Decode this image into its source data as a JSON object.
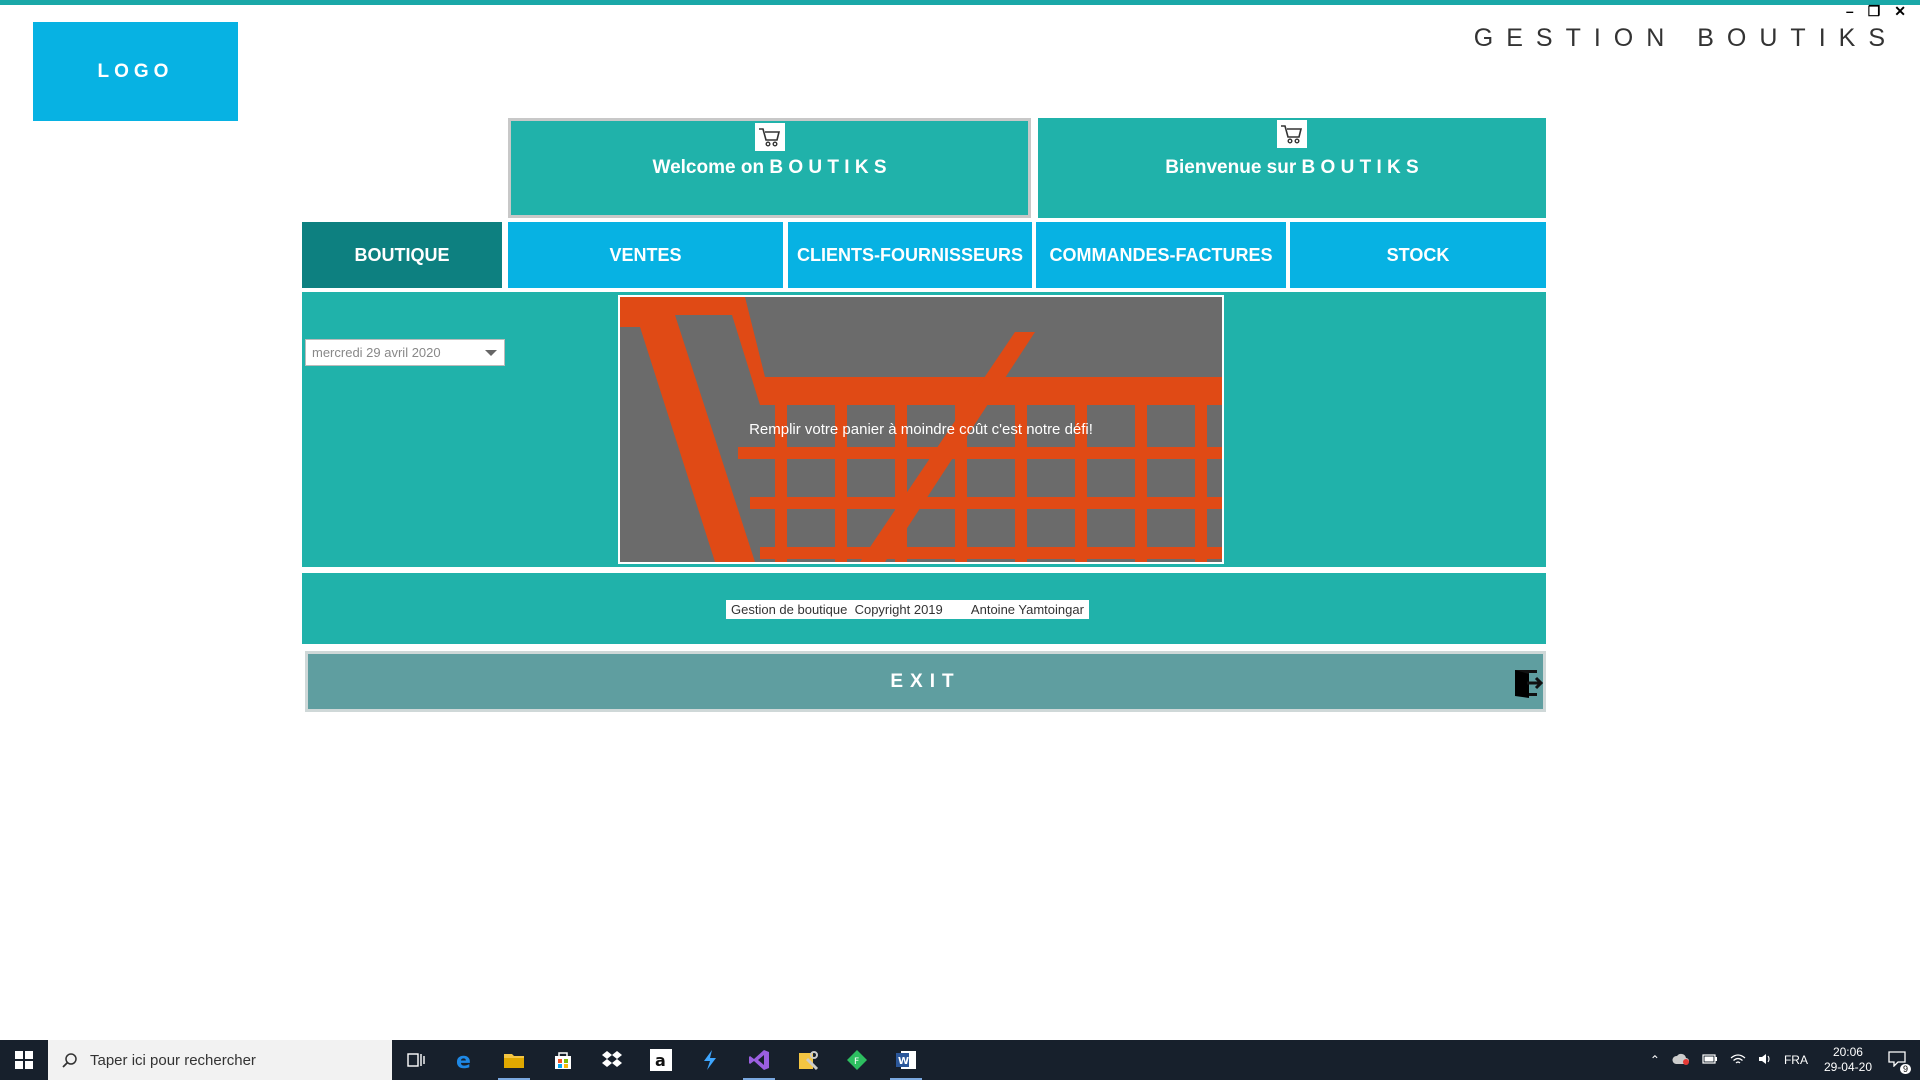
{
  "header": {
    "logo_text": "LOGO",
    "app_title": "GESTION BOUTIKS"
  },
  "welcome": {
    "english": "Welcome on B O U T I K S",
    "french": "Bienvenue sur  B O U T I K S"
  },
  "nav": {
    "items": [
      {
        "label": "BOUTIQUE",
        "active": true
      },
      {
        "label": "VENTES",
        "active": false
      },
      {
        "label": "CLIENTS-FOURNISSEURS",
        "active": false
      },
      {
        "label": "COMMANDES-FACTURES",
        "active": false
      },
      {
        "label": "STOCK",
        "active": false
      }
    ]
  },
  "main": {
    "date_value": "mercredi 29 avril 2020",
    "banner_text": "Remplir votre panier à moindre coût c'est notre défi!"
  },
  "footer": {
    "copyright": "Gestion de boutique  Copyright 2019        Antoine Yamtoingar"
  },
  "exit": {
    "label": "EXIT"
  },
  "taskbar": {
    "search_placeholder": "Taper ici pour rechercher",
    "language": "FRA",
    "time": "20:06",
    "date": "29-04-20",
    "notification_count": "9",
    "apps": [
      "task-view-icon",
      "edge-icon",
      "file-explorer-icon",
      "store-icon",
      "dropbox-icon",
      "amazon-icon",
      "vscode-icon",
      "visual-studio-icon",
      "tools-icon",
      "git-icon",
      "word-icon"
    ]
  },
  "colors": {
    "teal": "#20b2aa",
    "dark_teal": "#0d8080",
    "sky_blue": "#07b2e3",
    "exit_gray": "#5f9ea0",
    "cart_orange": "#e04a15"
  }
}
